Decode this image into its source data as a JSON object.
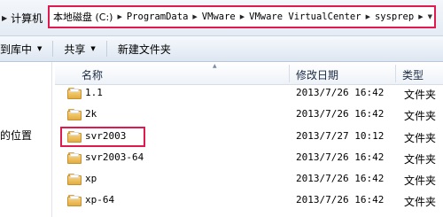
{
  "address_bar": {
    "left_label": "计算机",
    "crumbs": [
      "本地磁盘 (C:)",
      "ProgramData",
      "VMware",
      "VMware VirtualCenter",
      "sysprep"
    ]
  },
  "toolbar": {
    "include_in_library": "到库中",
    "share": "共享",
    "new_folder": "新建文件夹"
  },
  "nav": {
    "partial_label": "的位置"
  },
  "columns": {
    "name": "名称",
    "date": "修改日期",
    "type": "类型"
  },
  "files": [
    {
      "name": "1.1",
      "date": "2013/7/26 16:42",
      "type": "文件夹"
    },
    {
      "name": "2k",
      "date": "2013/7/26 16:42",
      "type": "文件夹"
    },
    {
      "name": "svr2003",
      "date": "2013/7/27 10:12",
      "type": "文件夹"
    },
    {
      "name": "svr2003-64",
      "date": "2013/7/26 16:42",
      "type": "文件夹"
    },
    {
      "name": "xp",
      "date": "2013/7/26 16:42",
      "type": "文件夹"
    },
    {
      "name": "xp-64",
      "date": "2013/7/26 16:42",
      "type": "文件夹"
    }
  ],
  "colors": {
    "highlight": "#e0194f",
    "folder": "#e3ad42"
  }
}
